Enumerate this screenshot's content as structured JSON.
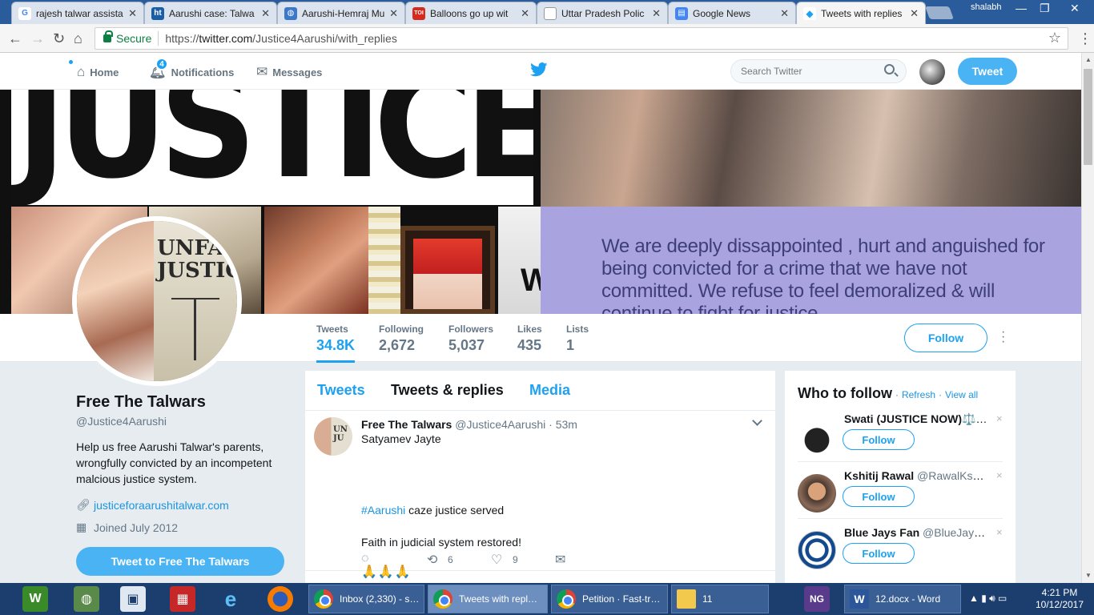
{
  "browser": {
    "tabs": [
      {
        "title": "rajesh talwar assista",
        "fav_color": "#4285f4",
        "fav_text": "G"
      },
      {
        "title": "Aarushi case: Talwa",
        "fav_color": "#1a5ea8",
        "fav_text": "ht"
      },
      {
        "title": "Aarushi-Hemraj Mu",
        "fav_color": "#3b78c9",
        "fav_text": "◍"
      },
      {
        "title": "Balloons go up wit",
        "fav_color": "#d52b1e",
        "fav_text": "TOI"
      },
      {
        "title": "Uttar Pradesh Polic",
        "fav_color": "#9e9e9e",
        "fav_text": ""
      },
      {
        "title": "Google News",
        "fav_color": "#4285f4",
        "fav_text": "▤"
      },
      {
        "title": "Tweets with replies",
        "fav_color": "#1da1f2",
        "fav_text": "🐦"
      }
    ],
    "user": "shalabh",
    "secure_label": "Secure",
    "url_prefix": "https://",
    "url_host": "twitter.com",
    "url_path": "/Justice4Aarushi/with_replies"
  },
  "twitter_nav": {
    "home": "Home",
    "notifications": "Notifications",
    "notification_count": "4",
    "messages": "Messages",
    "search_placeholder": "Search Twitter",
    "tweet_button": "Tweet"
  },
  "banner": {
    "headline": "JUSTICE!",
    "avatar_text": "UNFAIR JUSTICE",
    "quote": "We are deeply dissappointed , hurt and anguished for being convicted for a crime that we have not committed. We refuse to feel demoralized & will continue to fight for justice"
  },
  "profile_nav": {
    "stats": [
      {
        "label": "Tweets",
        "value": "34.8K"
      },
      {
        "label": "Following",
        "value": "2,672"
      },
      {
        "label": "Followers",
        "value": "5,037"
      },
      {
        "label": "Likes",
        "value": "435"
      },
      {
        "label": "Lists",
        "value": "1"
      }
    ],
    "follow": "Follow"
  },
  "profile": {
    "name": "Free The Talwars",
    "handle": "@Justice4Aarushi",
    "bio": "Help us free Aarushi Talwar's parents, wrongfully convicted by an incompetent malcious justice system.",
    "link": "justiceforaarushitalwar.com",
    "joined": "Joined July 2012",
    "tweet_to": "Tweet to Free The Talwars"
  },
  "timeline": {
    "tabs": [
      "Tweets",
      "Tweets & replies",
      "Media"
    ],
    "tweet": {
      "name": "Free The Talwars",
      "handle": "@Justice4Aarushi",
      "time": "· 53m",
      "line1": "Satyamev Jayte",
      "hashtag": "#Aarushi",
      "line2_rest": " caze justice served",
      "line3": "Faith in judicial system restored!",
      "line4": "🙏🙏🙏",
      "retweets": "6",
      "likes": "9"
    }
  },
  "who_to_follow": {
    "title": "Who to follow",
    "dot": "·",
    "refresh": "Refresh",
    "view_all": "View all",
    "follow_label": "Follow",
    "close": "×",
    "suggestions": [
      {
        "name": "Swati (JUSTICE NOW)⚖️",
        "handle": "…"
      },
      {
        "name": "Kshitij Rawal",
        "handle": "@RawalKshitij"
      },
      {
        "name": "Blue Jays Fan",
        "handle": "@BlueJaysfa…"
      }
    ]
  },
  "taskbar": {
    "apps": [
      {
        "label": "Inbox (2,330) - s…"
      },
      {
        "label": "Tweets with repl…"
      },
      {
        "label": "Petition · Fast-tr…"
      },
      {
        "label": "11"
      },
      {
        "label": "12.docx - Word"
      }
    ],
    "time": "4:21 PM",
    "date": "10/12/2017"
  }
}
